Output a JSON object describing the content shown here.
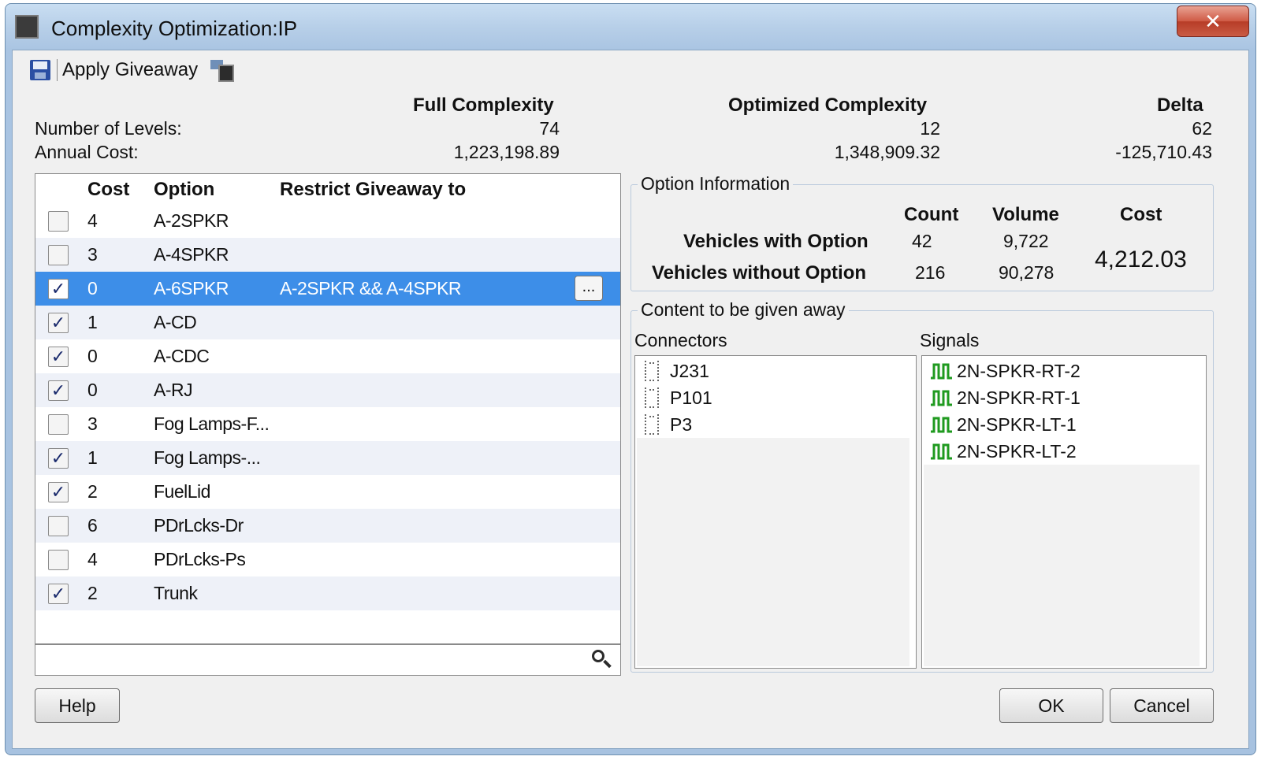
{
  "window": {
    "title": "Complexity Optimization:IP",
    "close_label": "✕"
  },
  "toolbar": {
    "apply_label": "Apply Giveaway"
  },
  "summary": {
    "headers": [
      "Full Complexity",
      "Optimized Complexity",
      "Delta"
    ],
    "rows": [
      {
        "label": "Number of Levels:",
        "values": [
          "74",
          "12",
          "62"
        ]
      },
      {
        "label": "Annual Cost:",
        "values": [
          "1,223,198.89",
          "1,348,909.32",
          "-125,710.43"
        ]
      }
    ]
  },
  "options_table": {
    "columns": [
      "Cost",
      "Option",
      "Restrict Giveaway to"
    ],
    "rows": [
      {
        "checked": false,
        "cost": "4",
        "option": "A-2SPKR",
        "restrict": ""
      },
      {
        "checked": false,
        "cost": "3",
        "option": "A-4SPKR",
        "restrict": ""
      },
      {
        "checked": true,
        "cost": "0",
        "option": "A-6SPKR",
        "restrict": "A-2SPKR && A-4SPKR",
        "selected": true
      },
      {
        "checked": true,
        "cost": "1",
        "option": "A-CD",
        "restrict": ""
      },
      {
        "checked": true,
        "cost": "0",
        "option": "A-CDC",
        "restrict": ""
      },
      {
        "checked": true,
        "cost": "0",
        "option": "A-RJ",
        "restrict": ""
      },
      {
        "checked": false,
        "cost": "3",
        "option": "Fog Lamps-F...",
        "restrict": ""
      },
      {
        "checked": true,
        "cost": "1",
        "option": "Fog Lamps-...",
        "restrict": ""
      },
      {
        "checked": true,
        "cost": "2",
        "option": "FuelLid",
        "restrict": ""
      },
      {
        "checked": false,
        "cost": "6",
        "option": "PDrLcks-Dr",
        "restrict": ""
      },
      {
        "checked": false,
        "cost": "4",
        "option": "PDrLcks-Ps",
        "restrict": ""
      },
      {
        "checked": true,
        "cost": "2",
        "option": "Trunk",
        "restrict": ""
      }
    ],
    "ellipsis_label": "...",
    "search_value": ""
  },
  "option_info": {
    "title": "Option Information",
    "col_count": "Count",
    "col_volume": "Volume",
    "col_cost": "Cost",
    "with_label": "Vehicles with Option",
    "with_count": "42",
    "with_volume": "9,722",
    "without_label": "Vehicles without Option",
    "without_count": "216",
    "without_volume": "90,278",
    "cost_value": "4,212.03"
  },
  "content": {
    "title": "Content to be given away",
    "connectors_label": "Connectors",
    "signals_label": "Signals",
    "connectors": [
      "J231",
      "P101",
      "P3"
    ],
    "signals": [
      "2N-SPKR-RT-2",
      "2N-SPKR-RT-1",
      "2N-SPKR-LT-1",
      "2N-SPKR-LT-2"
    ]
  },
  "buttons": {
    "help": "Help",
    "ok": "OK",
    "cancel": "Cancel"
  },
  "colors": {
    "selection": "#3d8ee8",
    "signal_icon": "#1f9a1f",
    "save_icon": "#2a4fa3"
  }
}
